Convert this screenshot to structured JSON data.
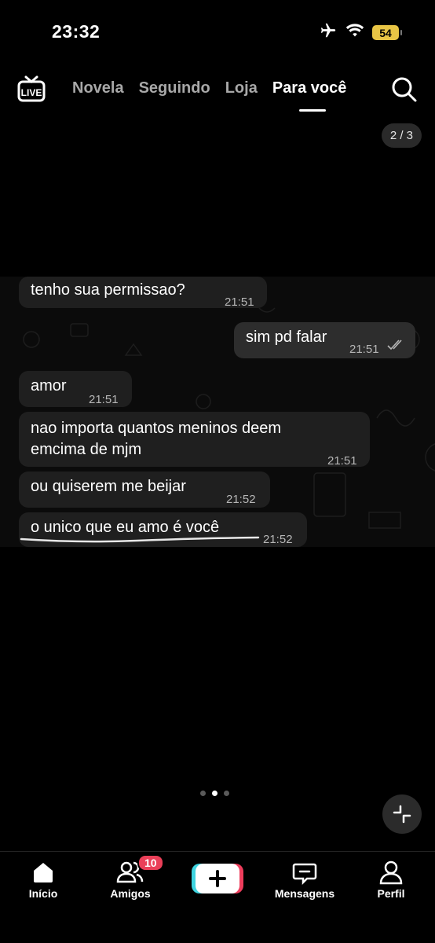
{
  "status_bar": {
    "time": "23:32",
    "battery": "54",
    "icons": [
      "airplane-icon",
      "wifi-icon",
      "battery-icon"
    ]
  },
  "top_nav": {
    "tabs": [
      {
        "label": "Novela",
        "active": false
      },
      {
        "label": "Seguindo",
        "active": false
      },
      {
        "label": "Loja",
        "active": false
      },
      {
        "label": "Para você",
        "active": true
      }
    ],
    "live_icon": "live-tv-icon",
    "live_label": "LIVE",
    "search_icon": "search-icon"
  },
  "post": {
    "page_counter": "2 / 3",
    "carousel_dots": 3,
    "carousel_active_index": 1
  },
  "chat": {
    "messages": [
      {
        "text": "tenho sua permissao?",
        "time": "21:51",
        "direction": "received"
      },
      {
        "text": "sim pd falar",
        "time": "21:51",
        "direction": "sent",
        "read": true
      },
      {
        "text": "amor",
        "time": "21:51",
        "direction": "received"
      },
      {
        "text": "nao importa quantos meninos deem\nemcima de mjm",
        "time": "21:51",
        "direction": "received"
      },
      {
        "text": "ou quiserem me beijar",
        "time": "21:52",
        "direction": "received"
      },
      {
        "text": "o unico que eu amo é você",
        "time": "21:52",
        "direction": "received",
        "underlined": true
      }
    ]
  },
  "bottom_nav": {
    "items": [
      {
        "label": "Início",
        "icon": "home-icon"
      },
      {
        "label": "Amigos",
        "icon": "friends-icon",
        "badge": "10"
      },
      {
        "label": "",
        "icon": "create-plus-icon"
      },
      {
        "label": "Mensagens",
        "icon": "messages-icon"
      },
      {
        "label": "Perfil",
        "icon": "profile-icon"
      }
    ]
  },
  "colors": {
    "background": "#000000",
    "bubble_received": "#1f1f1f",
    "bubble_sent": "#2d2d2d",
    "battery": "#e8c545",
    "badge": "#ea3f58",
    "create_cyan": "#3fd4e0",
    "create_red": "#ee3d5c"
  }
}
